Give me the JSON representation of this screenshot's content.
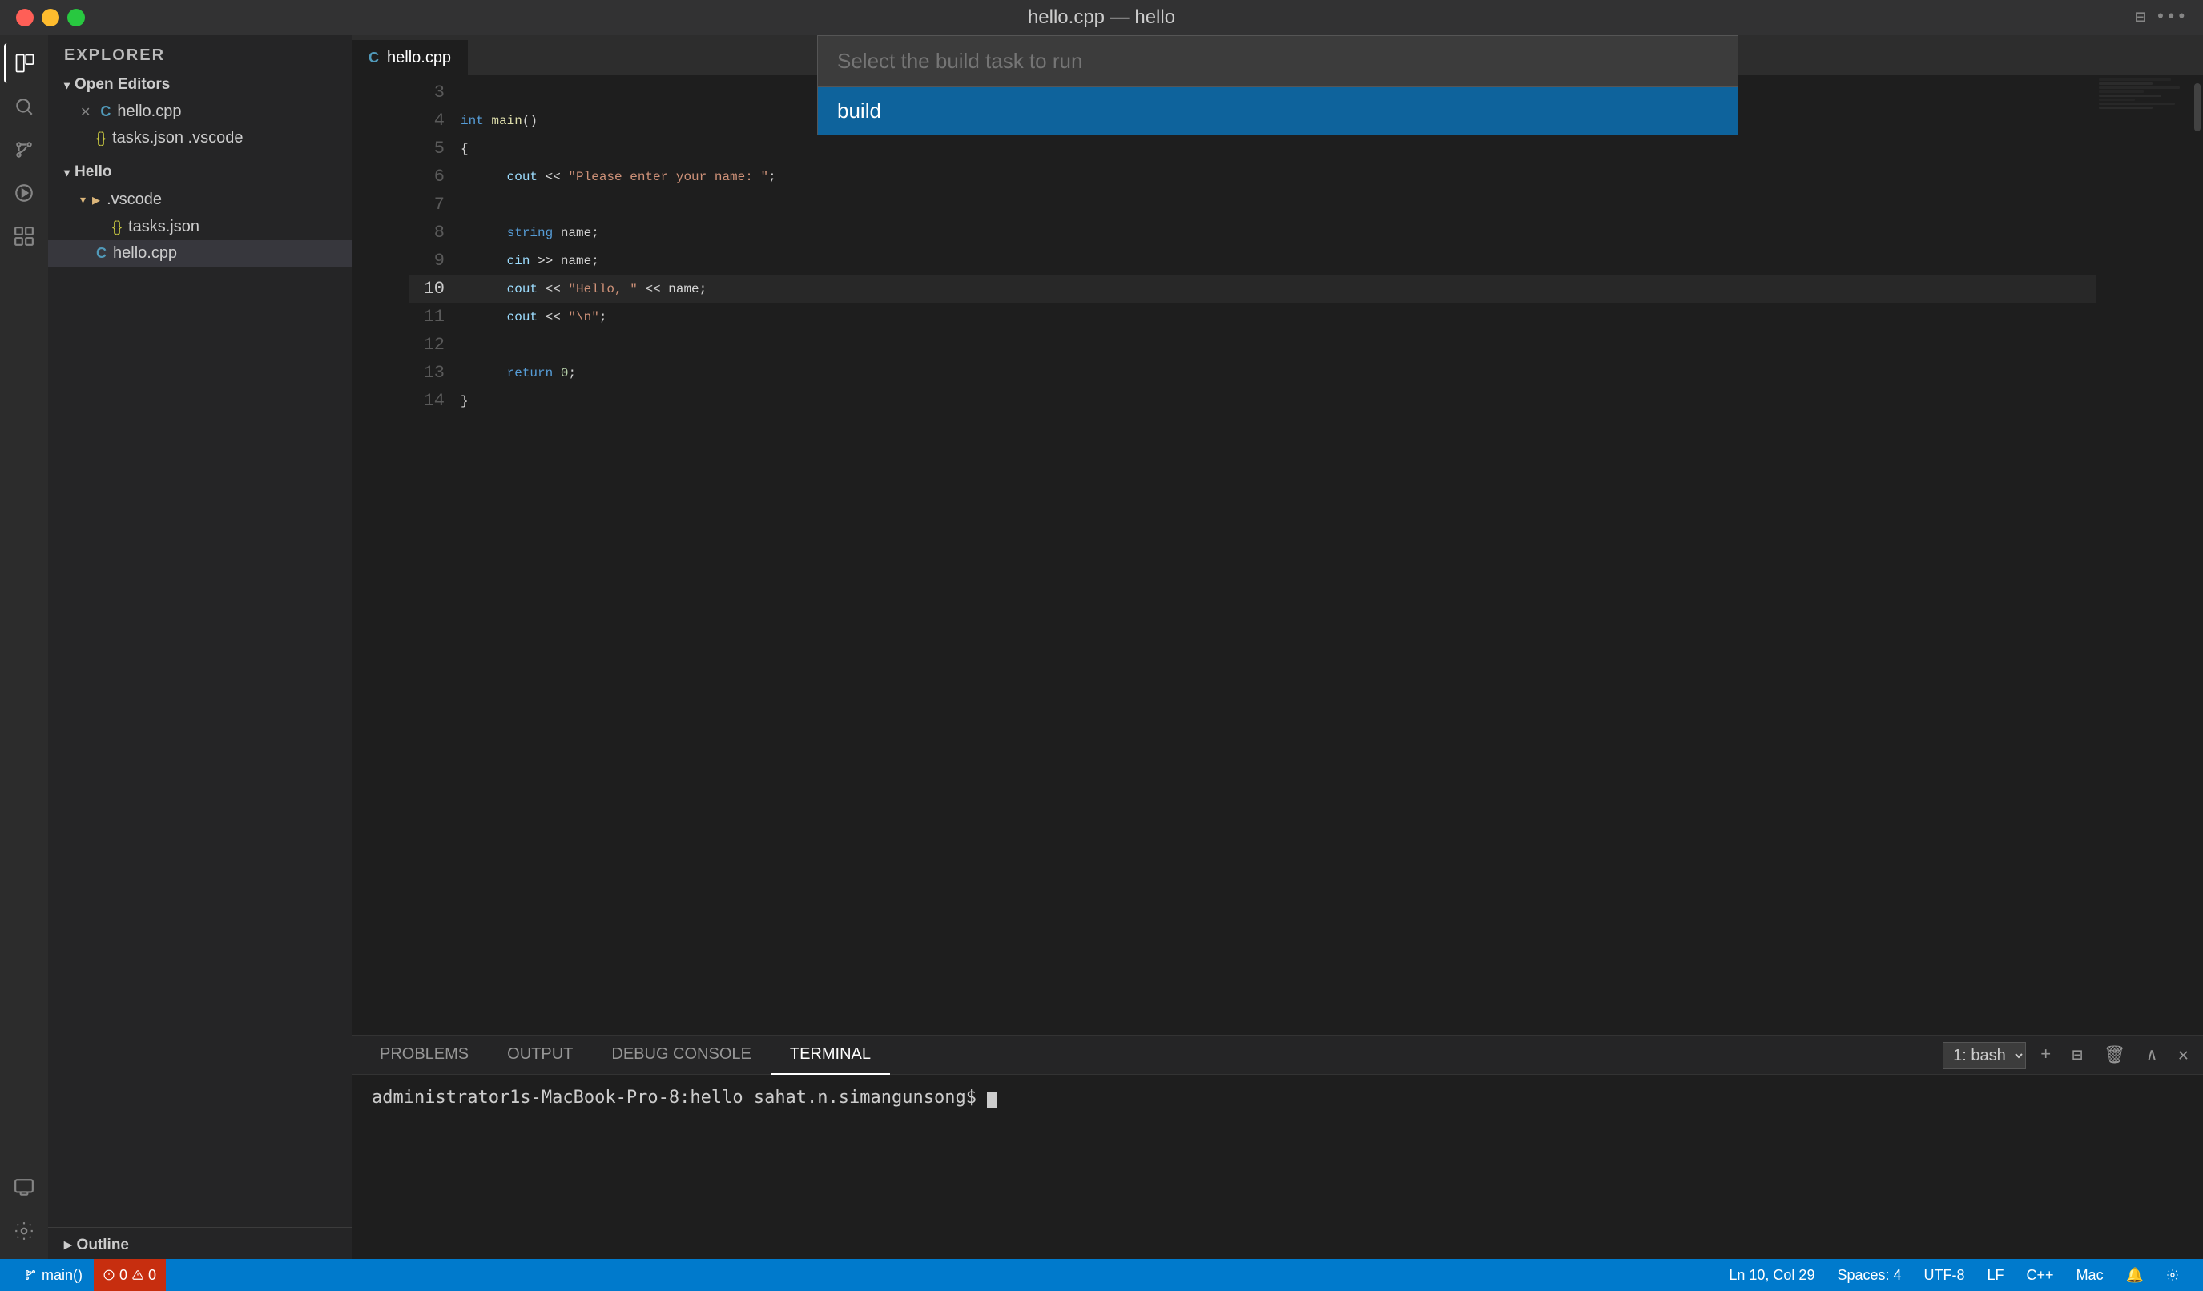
{
  "titleBar": {
    "title": "hello.cpp — hello",
    "buttons": {
      "close": "close",
      "minimize": "minimize",
      "maximize": "maximize"
    }
  },
  "activityBar": {
    "icons": [
      {
        "name": "explorer-icon",
        "symbol": "⧉",
        "active": true
      },
      {
        "name": "search-icon",
        "symbol": "🔍",
        "active": false
      },
      {
        "name": "source-control-icon",
        "symbol": "⑂",
        "active": false
      },
      {
        "name": "debug-icon",
        "symbol": "▷",
        "active": false
      },
      {
        "name": "extensions-icon",
        "symbol": "⊞",
        "active": false
      }
    ],
    "bottomIcons": [
      {
        "name": "remote-icon",
        "symbol": "⊞"
      },
      {
        "name": "settings-icon",
        "symbol": "⚙"
      }
    ]
  },
  "sidebar": {
    "header": "Explorer",
    "openEditors": {
      "label": "Open Editors",
      "items": [
        {
          "name": "hello.cpp",
          "icon": "cpp",
          "modified": true,
          "path": "hello.cpp"
        },
        {
          "name": "tasks.json .vscode",
          "icon": "json",
          "modified": false,
          "path": "tasks.json .vscode"
        }
      ]
    },
    "hello": {
      "label": "Hello",
      "items": [
        {
          "name": ".vscode",
          "icon": "folder",
          "indent": 1
        },
        {
          "name": "tasks.json",
          "icon": "json",
          "indent": 2
        },
        {
          "name": "hello.cpp",
          "icon": "cpp",
          "indent": 1,
          "active": true
        }
      ]
    },
    "outline": {
      "label": "Outline"
    }
  },
  "tabs": [
    {
      "label": "hello.cpp",
      "active": true,
      "icon": "cpp"
    }
  ],
  "commandPalette": {
    "placeholder": "Select the build task to run",
    "items": [
      {
        "label": "build",
        "selected": true
      }
    ]
  },
  "editor": {
    "lines": [
      {
        "num": 3,
        "content": "",
        "tokens": []
      },
      {
        "num": 4,
        "content": "int main()",
        "tokens": [
          {
            "type": "kw",
            "text": "int"
          },
          {
            "type": "op",
            "text": " main()"
          }
        ]
      },
      {
        "num": 5,
        "content": "{",
        "tokens": [
          {
            "type": "op",
            "text": "{"
          }
        ]
      },
      {
        "num": 6,
        "content": "    cout << \"Please enter your name: \";",
        "tokens": [
          {
            "type": "var",
            "text": "    cout"
          },
          {
            "type": "op",
            "text": " << "
          },
          {
            "type": "str",
            "text": "\"Please enter your name: \""
          },
          {
            "type": "op",
            "text": ";"
          }
        ]
      },
      {
        "num": 7,
        "content": "",
        "tokens": []
      },
      {
        "num": 8,
        "content": "    string name;",
        "tokens": [
          {
            "type": "kw",
            "text": "    string"
          },
          {
            "type": "op",
            "text": " name;"
          }
        ]
      },
      {
        "num": 9,
        "content": "    cin >> name;",
        "tokens": [
          {
            "type": "var",
            "text": "    cin"
          },
          {
            "type": "op",
            "text": " >> name;"
          }
        ]
      },
      {
        "num": 10,
        "content": "    cout << \"Hello, \" << name;",
        "tokens": [
          {
            "type": "var",
            "text": "    cout"
          },
          {
            "type": "op",
            "text": " << "
          },
          {
            "type": "str",
            "text": "\"Hello, \""
          },
          {
            "type": "op",
            "text": " << name;"
          }
        ],
        "highlighted": true
      },
      {
        "num": 11,
        "content": "    cout << \"\\n\";",
        "tokens": [
          {
            "type": "var",
            "text": "    cout"
          },
          {
            "type": "op",
            "text": " << "
          },
          {
            "type": "str",
            "text": "\"\\n\""
          },
          {
            "type": "op",
            "text": ";"
          }
        ]
      },
      {
        "num": 12,
        "content": "",
        "tokens": []
      },
      {
        "num": 13,
        "content": "    return 0;",
        "tokens": [
          {
            "type": "kw",
            "text": "    return"
          },
          {
            "type": "op",
            "text": " "
          },
          {
            "type": "num",
            "text": "0"
          },
          {
            "type": "op",
            "text": ";"
          }
        ]
      },
      {
        "num": 14,
        "content": "}",
        "tokens": [
          {
            "type": "op",
            "text": "}"
          }
        ]
      }
    ]
  },
  "bottomPanel": {
    "tabs": [
      {
        "label": "PROBLEMS",
        "active": false
      },
      {
        "label": "OUTPUT",
        "active": false
      },
      {
        "label": "DEBUG CONSOLE",
        "active": false
      },
      {
        "label": "TERMINAL",
        "active": true
      }
    ],
    "terminal": {
      "shell": "1: bash",
      "prompt": "administrator1s-MacBook-Pro-8:hello sahat.n.simangunsong$"
    }
  },
  "statusBar": {
    "branch": "main()",
    "errors": "0",
    "warnings": "0",
    "position": "Ln 10, Col 29",
    "spaces": "Spaces: 4",
    "encoding": "UTF-8",
    "lineEnding": "LF",
    "language": "C++",
    "platform": "Mac",
    "feedbackIcon": "🔔",
    "settingsIcon": "⚙"
  }
}
